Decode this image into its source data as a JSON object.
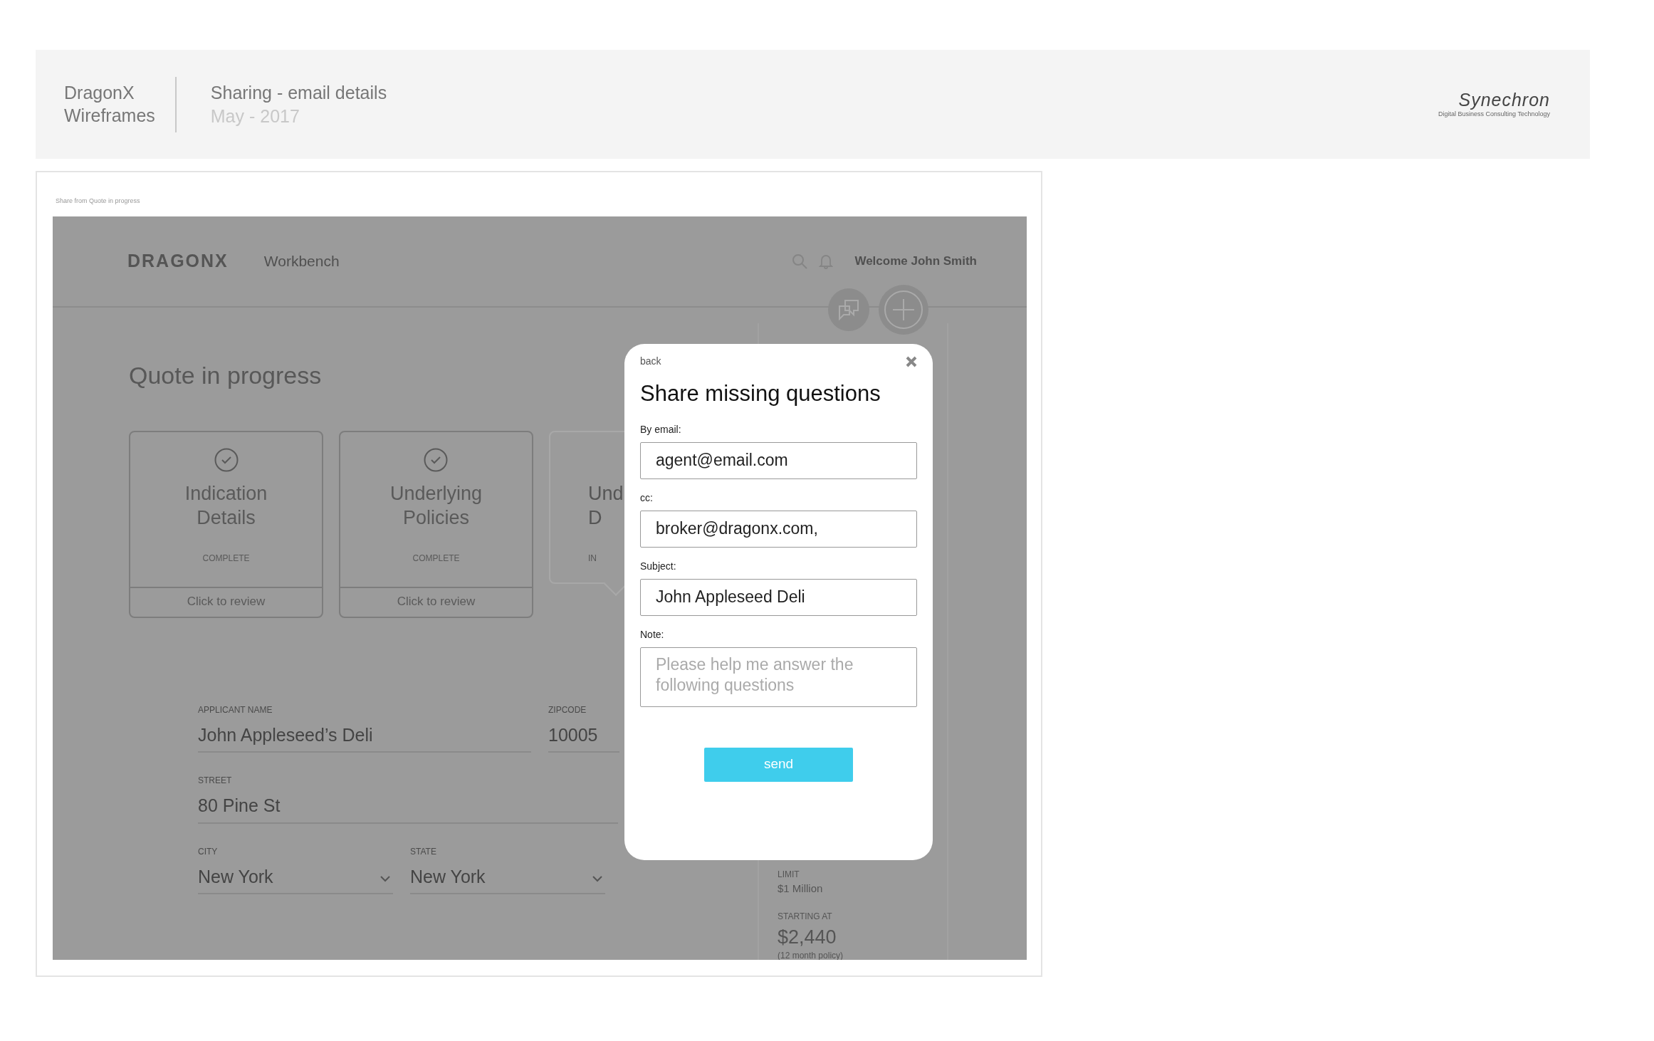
{
  "header": {
    "project_lines": [
      "DragonX",
      "Wireframes"
    ],
    "page_title": "Sharing - email details",
    "date": "May - 2017",
    "logo": {
      "name": "Synechron",
      "tagline": "Digital  Business Consulting  Technology"
    }
  },
  "frame": {
    "caption": "Share from Quote in progress"
  },
  "app": {
    "brand": "DRAGONX",
    "nav_link": "Workbench",
    "welcome": "Welcome John Smith",
    "page_title": "Quote in progress",
    "cards": [
      {
        "kind": "done",
        "title_lines": [
          "Indication",
          "Details"
        ],
        "status": "COMPLETE",
        "action": "Click to review"
      },
      {
        "kind": "done",
        "title_lines": [
          "Underlying",
          "Policies"
        ],
        "status": "COMPLETE",
        "action": "Click to review"
      },
      {
        "kind": "partial",
        "title_lines": [
          "Und",
          "D"
        ],
        "status": "IN"
      }
    ],
    "field_rows": [
      [
        {
          "kind": "text",
          "label": "APPLICANT NAME",
          "value": "John Appleseed’s Deli"
        },
        {
          "kind": "text",
          "label": "ZIPCODE",
          "value": "10005"
        }
      ],
      [
        {
          "kind": "text",
          "label": "STREET",
          "value": "80 Pine St"
        }
      ],
      [
        {
          "kind": "select",
          "label": "CITY",
          "value": "New York"
        },
        {
          "kind": "select",
          "label": "STATE",
          "value": "New York"
        }
      ]
    ],
    "summary": [
      {
        "label": "LIMIT",
        "value": "$1 Million"
      },
      {
        "label": "STARTING AT",
        "value": "$2,440",
        "note": "(12 month policy)"
      }
    ]
  },
  "dialog": {
    "back": "back",
    "title": "Share missing questions",
    "fields": [
      {
        "kind": "input",
        "label": "By email:",
        "value": "agent@email.com"
      },
      {
        "kind": "input",
        "label": "cc:",
        "value": "broker@dragonx.com,"
      },
      {
        "kind": "input",
        "label": "Subject:",
        "value": "John Appleseed Deli"
      },
      {
        "kind": "textarea",
        "label": "Note:",
        "placeholder": "Please help me answer the following questions"
      }
    ],
    "button": "send"
  }
}
